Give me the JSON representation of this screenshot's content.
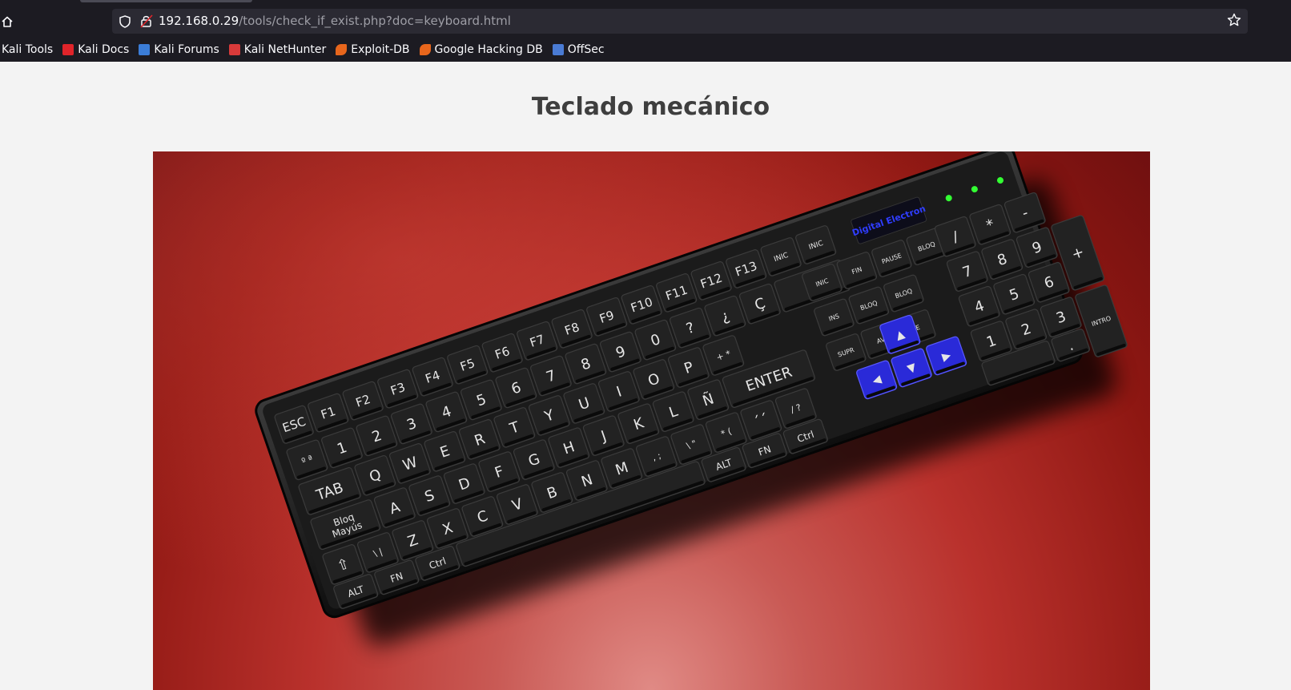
{
  "browser": {
    "url_host": "192.168.0.29",
    "url_path": "/tools/check_if_exist.php?doc=keyboard.html",
    "bookmarks": [
      {
        "label": "Kali Tools",
        "icon": "kali-tools-icon",
        "color": "#1c1b22"
      },
      {
        "label": "Kali Docs",
        "icon": "kali-docs-icon",
        "color": "#e0242a"
      },
      {
        "label": "Kali Forums",
        "icon": "kali-forums-icon",
        "color": "#3b7dd8"
      },
      {
        "label": "Kali NetHunter",
        "icon": "kali-nethunter-icon",
        "color": "#d83a3a"
      },
      {
        "label": "Exploit-DB",
        "icon": "exploit-db-icon",
        "color": "#e8661c"
      },
      {
        "label": "Google Hacking DB",
        "icon": "google-hacking-db-icon",
        "color": "#e8661c"
      },
      {
        "label": "OffSec",
        "icon": "offsec-icon",
        "color": "#4a7bd4"
      }
    ]
  },
  "page": {
    "title": "Teclado mecánico",
    "image": {
      "brand": "Digital Electron",
      "colors": {
        "background": "#b9312c",
        "keyboard": "#1e1e1e",
        "arrows": "#2a2ad8",
        "leds": "#33ff33"
      },
      "rows": {
        "fn": [
          "ESC",
          "F1",
          "F2",
          "F3",
          "F4",
          "F5",
          "F6",
          "F7",
          "F8",
          "F9",
          "F10",
          "F11",
          "F12",
          "F13",
          "INIC",
          "INIC"
        ],
        "num": [
          "º ª",
          "1",
          "2",
          "3",
          "4",
          "5",
          "6",
          "7",
          "8",
          "9",
          "0",
          "?",
          "¿",
          "Ç"
        ],
        "top": [
          "TAB",
          "Q",
          "W",
          "E",
          "R",
          "T",
          "Y",
          "U",
          "I",
          "O",
          "P",
          "+ *"
        ],
        "home": [
          "Bloq Mayús",
          "A",
          "S",
          "D",
          "F",
          "G",
          "H",
          "J",
          "K",
          "L",
          "Ñ",
          "ENTER"
        ],
        "bottom": [
          "⇧",
          "\\ |",
          "Z",
          "X",
          "C",
          "V",
          "B",
          "N",
          "M",
          ", ;",
          "\\ \"",
          "* (",
          "´´",
          "/ ?"
        ],
        "space": [
          "ALT",
          "FN",
          "Ctrl",
          "",
          "ALT",
          "FN",
          "Ctrl"
        ],
        "nav": [
          "INIC",
          "FIN",
          "PAUSE",
          "BLOQ",
          "INS",
          "BLOQ",
          "BLOQ",
          "SUPR",
          "AV",
          "RE"
        ],
        "numpad": [
          "/",
          "*",
          "-",
          "7",
          "8",
          "9",
          "+",
          "4",
          "5",
          "6",
          "1",
          "2",
          "3",
          "INTRO",
          "."
        ]
      }
    }
  }
}
